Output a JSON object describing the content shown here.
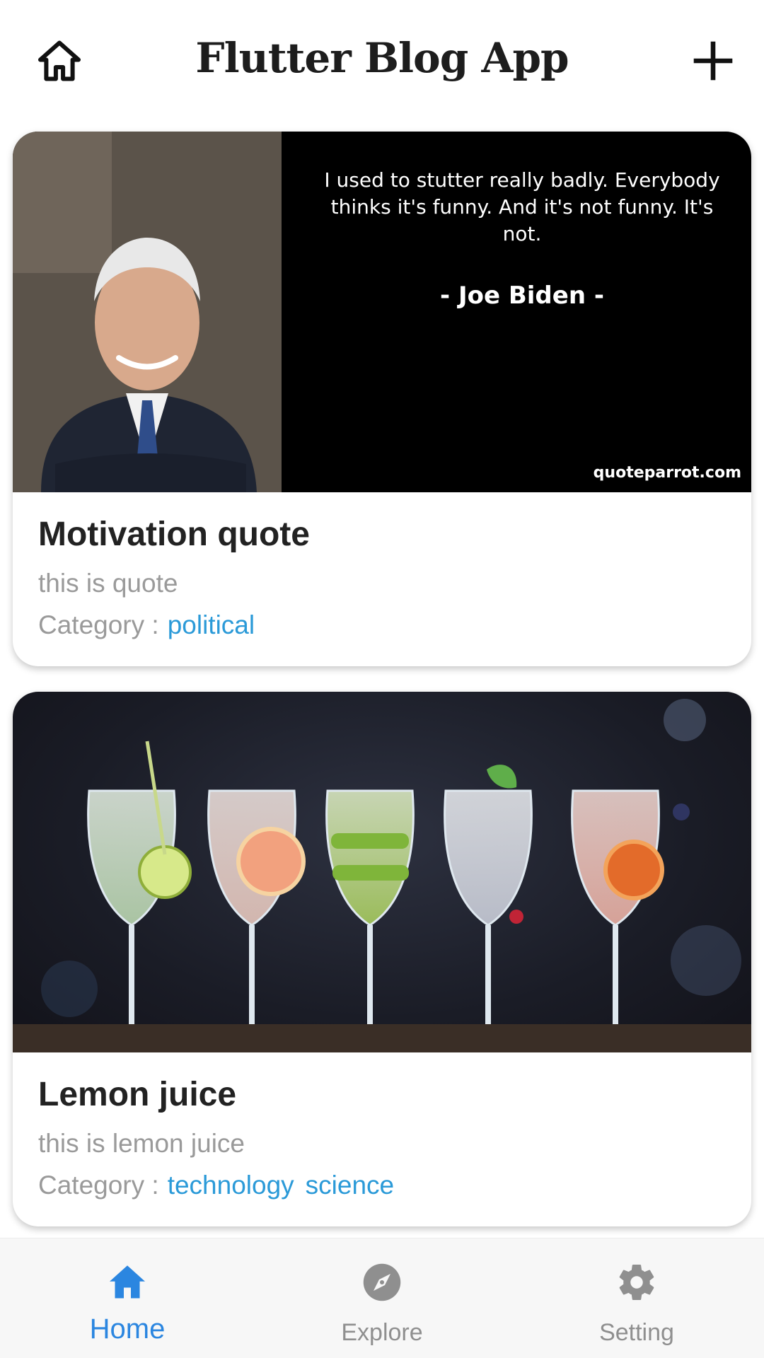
{
  "app_bar": {
    "title": "Flutter Blog App",
    "home_icon": "home-outline-icon",
    "add_icon": "plus-icon"
  },
  "posts": [
    {
      "title": "Motivation quote",
      "description": "this is quote",
      "category_label": "Category :",
      "categories": [
        "political"
      ],
      "image": {
        "quote": "I used to stutter really badly. Everybody thinks it's funny. And it's not funny. It's not.",
        "author": "- Joe Biden -",
        "source": "quoteparrot.com"
      }
    },
    {
      "title": "Lemon juice",
      "description": "this is lemon juice",
      "category_label": "Category :",
      "categories": [
        "technology",
        "science"
      ]
    }
  ],
  "bottom_nav": {
    "items": [
      {
        "label": "Home",
        "icon": "home-icon",
        "active": true
      },
      {
        "label": "Explore",
        "icon": "compass-icon",
        "active": false
      },
      {
        "label": "Setting",
        "icon": "gear-icon",
        "active": false
      }
    ]
  },
  "colors": {
    "accent": "#2b86e0",
    "category_link": "#2b9ad8",
    "muted_text": "#9a9a9a",
    "title_text": "#222222"
  }
}
